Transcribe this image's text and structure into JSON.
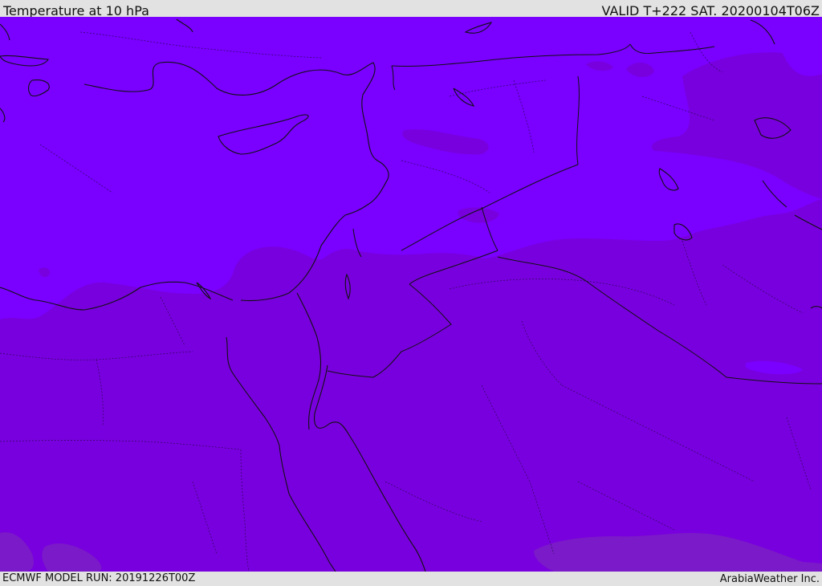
{
  "header": {
    "title": "Temperature at 10 hPa",
    "valid_time": "VALID T+222 SAT. 20200104T06Z"
  },
  "footer": {
    "model_run": "ECMWF MODEL RUN: 20191226T00Z",
    "credit": "ArabiaWeather Inc."
  },
  "map": {
    "fill_colors": {
      "cold_band": "#7a00ff",
      "warmer_band": "#7900de",
      "warmest_patch": "#7b1ac8",
      "coast_line": "#111111"
    }
  }
}
